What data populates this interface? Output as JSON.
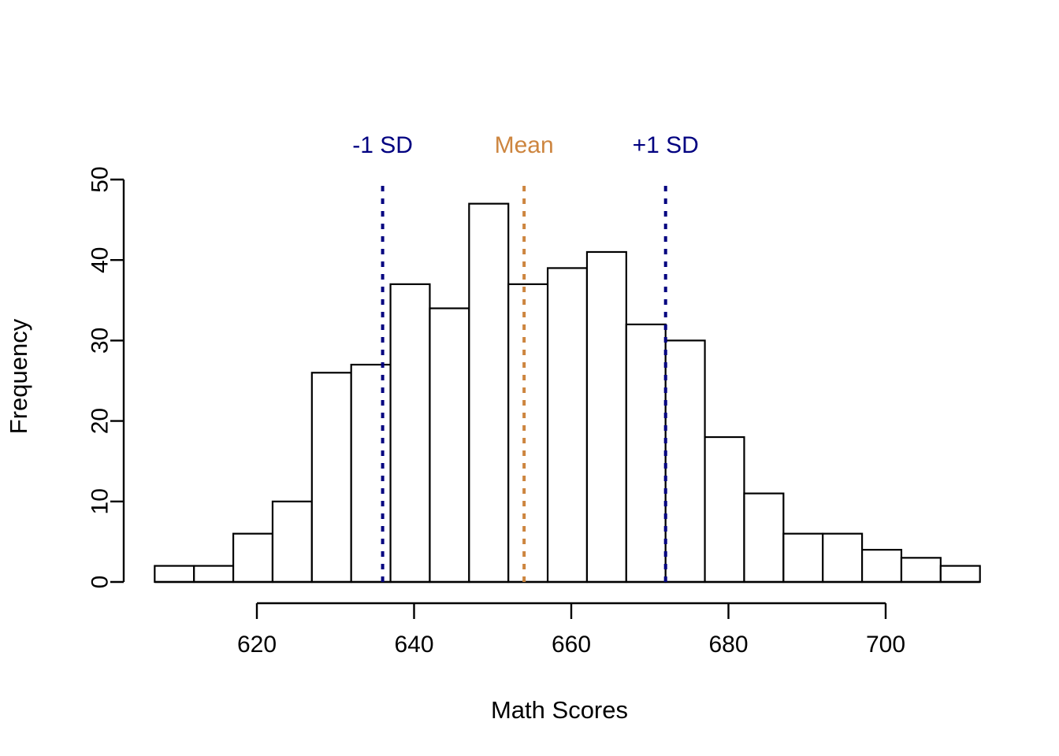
{
  "chart_data": {
    "type": "bar",
    "title": "",
    "xlabel": "Math Scores",
    "ylabel": "Frequency",
    "xlim": [
      604,
      712
    ],
    "ylim": [
      0,
      50
    ],
    "grid": false,
    "legend": "none",
    "bin_width": 5,
    "bin_starts": [
      607,
      612,
      617,
      622,
      627,
      632,
      637,
      642,
      647,
      652,
      657,
      662,
      667,
      672,
      677,
      682,
      687,
      692,
      697,
      702,
      707
    ],
    "categories": [
      "607-612",
      "612-617",
      "617-622",
      "622-627",
      "627-632",
      "632-637",
      "637-642",
      "642-647",
      "647-652",
      "652-657",
      "657-662",
      "662-667",
      "667-672",
      "672-677",
      "677-682",
      "682-687",
      "687-692",
      "692-697",
      "697-702",
      "702-707",
      "707-712"
    ],
    "values": [
      2,
      2,
      6,
      10,
      26,
      27,
      37,
      34,
      47,
      37,
      39,
      41,
      32,
      30,
      18,
      11,
      6,
      6,
      4,
      3,
      2
    ],
    "x_ticks": [
      620,
      640,
      660,
      680,
      700
    ],
    "x_tick_labels": [
      "620",
      "640",
      "660",
      "680",
      "700"
    ],
    "y_ticks": [
      0,
      10,
      20,
      30,
      40,
      50
    ],
    "y_tick_labels": [
      "0",
      "10",
      "20",
      "30",
      "40",
      "50"
    ],
    "annotations": [
      {
        "label": "-1 SD",
        "x": 636,
        "color": "#000080",
        "style": "dashed-vertical"
      },
      {
        "label": "Mean",
        "x": 654,
        "color": "#CD853F",
        "style": "dashed-vertical"
      },
      {
        "label": "+1 SD",
        "x": 672,
        "color": "#000080",
        "style": "dashed-vertical"
      }
    ]
  },
  "axes": {
    "x_title": "Math Scores",
    "y_title": "Frequency",
    "x_tick_labels": [
      "620",
      "640",
      "660",
      "680",
      "700"
    ],
    "y_tick_labels": [
      "0",
      "10",
      "20",
      "30",
      "40",
      "50"
    ]
  },
  "markers": {
    "sd_low_label": "-1 SD",
    "mean_label": "Mean",
    "sd_high_label": "+1 SD",
    "sd_color": "#000080",
    "mean_color": "#CD853F"
  },
  "colors": {
    "background": "#FFFFFF",
    "foreground": "#000000",
    "bar_fill": "#FFFFFF",
    "bar_stroke": "#000000",
    "sd_line": "#000080",
    "mean_line": "#CD853F"
  }
}
